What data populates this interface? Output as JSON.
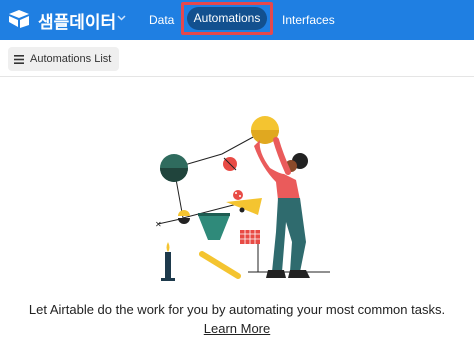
{
  "header": {
    "base_name": "샘플데이터",
    "tabs": [
      {
        "label": "Data",
        "active": false
      },
      {
        "label": "Automations",
        "active": true
      },
      {
        "label": "Interfaces",
        "active": false
      }
    ]
  },
  "subbar": {
    "list_button_label": "Automations List"
  },
  "empty_state": {
    "message": "Let Airtable do the work for you by automating your most common tasks.",
    "link_label": "Learn More"
  },
  "colors": {
    "topbar": "#1f7fe2",
    "active_tab": "#12508f",
    "highlight_border": "#e5484d"
  },
  "icons": [
    "airtable-logo-icon",
    "chevron-down-icon",
    "list-icon"
  ]
}
